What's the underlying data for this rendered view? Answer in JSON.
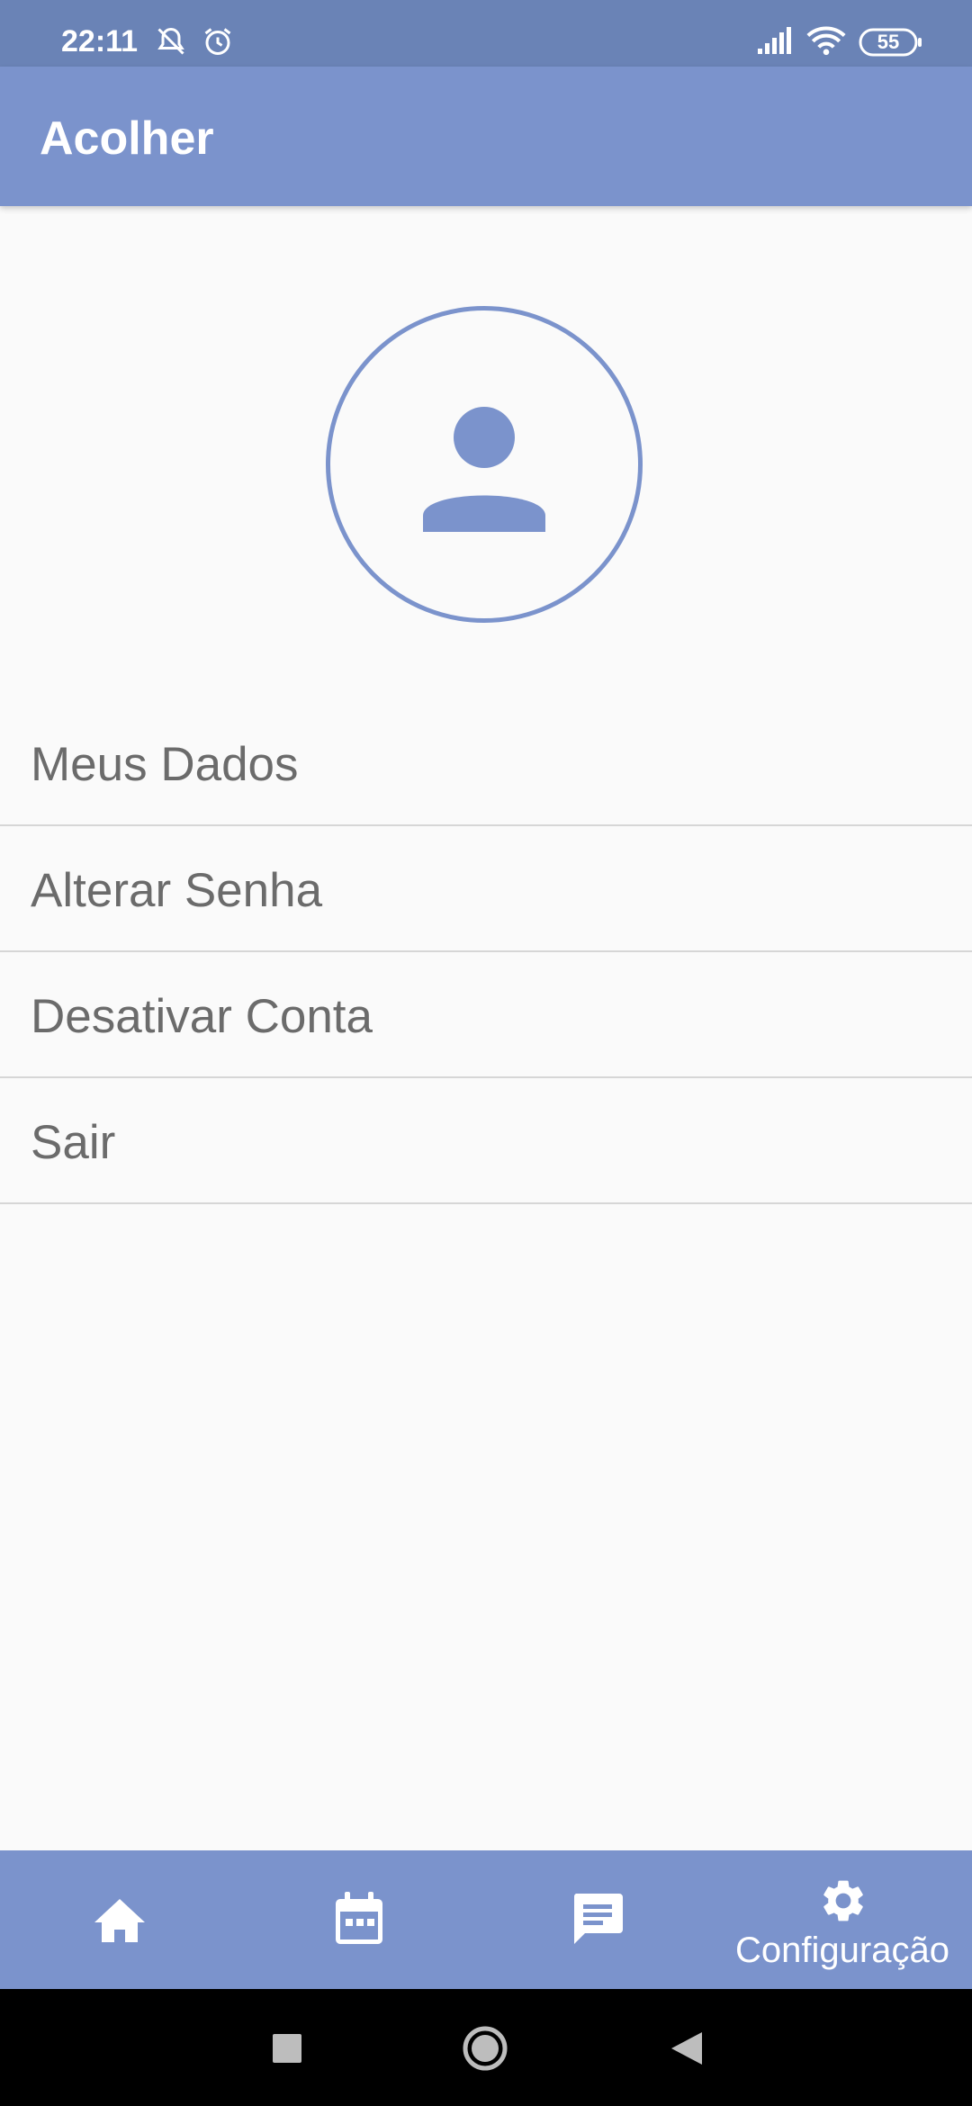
{
  "status_bar": {
    "time": "22:11",
    "battery": "55",
    "icons": [
      "bell-off-icon",
      "alarm-icon",
      "signal-icon",
      "wifi-icon",
      "battery-icon"
    ]
  },
  "app_bar": {
    "title": "Acolher"
  },
  "profile": {
    "avatar_icon": "person-icon"
  },
  "menu": {
    "items": [
      {
        "label": "Meus Dados"
      },
      {
        "label": "Alterar Senha"
      },
      {
        "label": "Desativar Conta"
      },
      {
        "label": "Sair"
      }
    ]
  },
  "bottom_nav": {
    "items": [
      {
        "icon": "home-icon"
      },
      {
        "icon": "calendar-icon"
      },
      {
        "icon": "message-icon"
      },
      {
        "icon": "gear-icon",
        "label": "Configuração"
      }
    ]
  },
  "system_nav": {
    "icons": [
      "recents-square-icon",
      "home-circle-icon",
      "back-triangle-icon"
    ]
  },
  "colors": {
    "primary": "#7b93cc",
    "status_bar": "#6a83b6",
    "background": "#fafafa",
    "menu_text": "#6b6b6b",
    "divider": "#d6d6d6"
  }
}
